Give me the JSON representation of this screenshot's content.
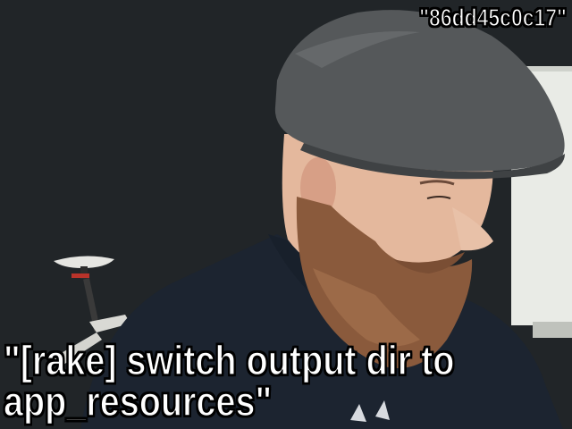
{
  "overlay": {
    "commit_hash": "\"86dd45c0c17\"",
    "commit_message_line1": "\"[rake] switch output dir to",
    "commit_message_line2": "app_resources\""
  },
  "scene": {
    "background_color": "#1f2326",
    "cap_color": "#55585a",
    "shirt_color": "#1c2430",
    "beard_color": "#8a5a3c",
    "skin_color": "#e7bfa6",
    "board_color": "#f2f2ee"
  }
}
